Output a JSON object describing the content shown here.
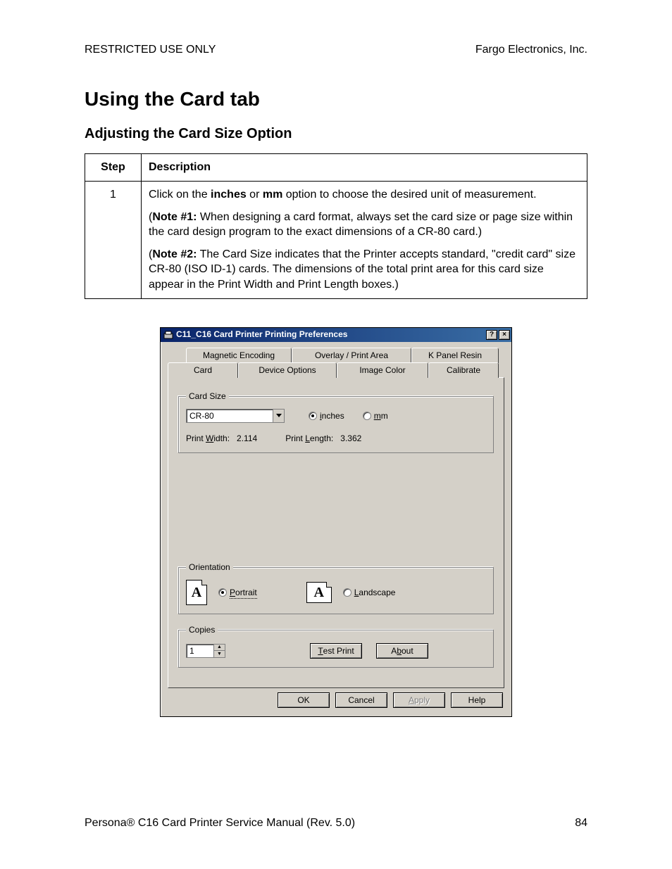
{
  "header": {
    "left": "RESTRICTED USE ONLY",
    "right": "Fargo Electronics, Inc."
  },
  "title": "Using the Card tab",
  "subtitle": "Adjusting the Card Size Option",
  "table": {
    "col_step": "Step",
    "col_desc": "Description",
    "step_num": "1",
    "p1_a": "Click on the ",
    "p1_b": "inches",
    "p1_c": " or ",
    "p1_d": "mm",
    "p1_e": " option to choose the desired unit of measurement.",
    "p2_a": "(",
    "p2_b": "Note #1:",
    "p2_c": "  When designing a card format, always set the card size or page size within the card design program to the exact dimensions of a CR-80 card.)",
    "p3_a": "(",
    "p3_b": "Note #2:",
    "p3_c": "  The Card Size indicates that the Printer accepts standard, \"credit card\" size CR-80 (ISO ID-1) cards. The dimensions of the total print area for this card size appear in the Print Width and Print Length boxes.)"
  },
  "dialog": {
    "title": "C11_C16 Card Printer Printing Preferences",
    "help_glyph": "?",
    "close_glyph": "×",
    "tabs_back": {
      "t1": "Magnetic Encoding",
      "t2": "Overlay / Print Area",
      "t3": "K Panel Resin"
    },
    "tabs_front": {
      "t1": "Card",
      "t2": "Device Options",
      "t3": "Image Color",
      "t4": "Calibrate"
    },
    "card_size": {
      "legend": "Card Size",
      "value": "CR-80",
      "inches_u": "i",
      "inches_rest": "nches",
      "mm_u": "m",
      "mm_rest": "m",
      "pw_label_u": "W",
      "pw_label_pre": "Print ",
      "pw_label_post": "idth:",
      "pw_value": "2.114",
      "pl_label_u": "L",
      "pl_label_pre": "Print ",
      "pl_label_post": "ength:",
      "pl_value": "3.362"
    },
    "orientation": {
      "legend": "Orientation",
      "icon_letter": "A",
      "portrait_u": "P",
      "portrait_rest": "ortrait",
      "landscape_u": "L",
      "landscape_rest": "andscape"
    },
    "copies": {
      "legend_u": "C",
      "legend_rest": "opies",
      "value": "1",
      "test_u": "T",
      "test_rest": "est Print",
      "about_u": "b",
      "about_pre": "A",
      "about_post": "out"
    },
    "buttons": {
      "ok": "OK",
      "cancel": "Cancel",
      "apply_u": "A",
      "apply_rest": "pply",
      "help": "Help"
    }
  },
  "footer": {
    "left_pre": "Persona",
    "left_reg": "®",
    "left_post": " C16 Card Printer Service Manual (Rev. 5.0)",
    "page": "84"
  }
}
